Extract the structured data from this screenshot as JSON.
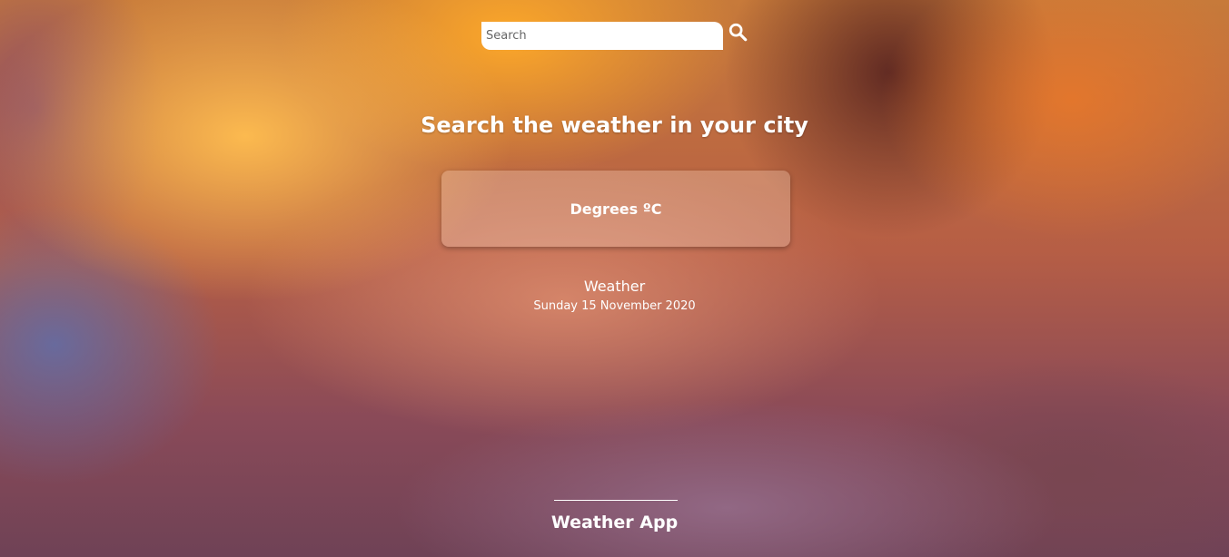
{
  "search": {
    "placeholder": "Search",
    "value": "",
    "icon": "search-icon"
  },
  "headline": "Search the weather in your city",
  "weather_card": {
    "temperature_label": "Degrees ºC"
  },
  "weather": {
    "condition": "Weather",
    "date": "Sunday 15 November 2020"
  },
  "footer": {
    "title": "Weather App"
  },
  "colors": {
    "text": "#ffffff",
    "input_background": "#ffffff"
  }
}
